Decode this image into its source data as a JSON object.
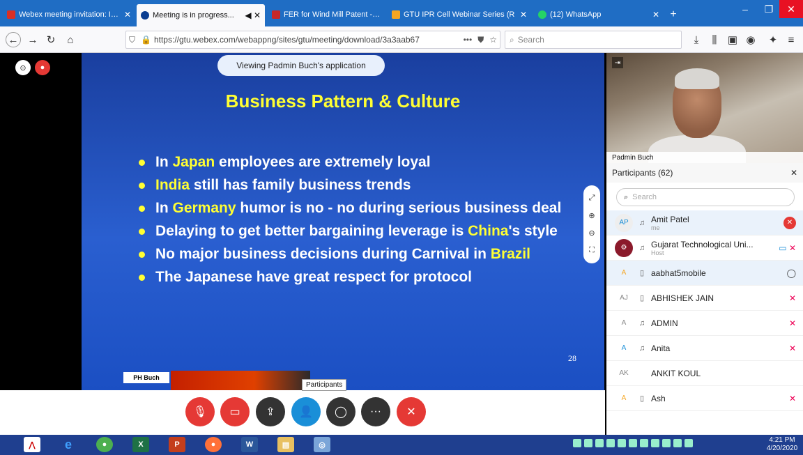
{
  "browser": {
    "tabs": [
      {
        "label": "Webex meeting invitation: Imp",
        "favicon_color": "#d93025",
        "active": false
      },
      {
        "label": "Meeting is in progress...",
        "favicon_color": "#0a3d91",
        "active": true
      },
      {
        "label": "FER for Wind Mill Patent - amit",
        "favicon_color": "#c62828",
        "active": false
      },
      {
        "label": "GTU IPR Cell Webinar Series (R",
        "favicon_color": "#f5a623",
        "active": false
      },
      {
        "label": "(12) WhatsApp",
        "favicon_color": "#25d366",
        "active": false
      }
    ],
    "url": "https://gtu.webex.com/webappng/sites/gtu/meeting/download/3a3aab67",
    "search_placeholder": "Search"
  },
  "meeting": {
    "viewing_banner": "Viewing Padmin Buch's application",
    "slide": {
      "title": "Business Pattern & Culture",
      "bullets": [
        {
          "pre": "In ",
          "hl": "Japan",
          "post": " employees are extremely loyal"
        },
        {
          "pre": "",
          "hl": "India",
          "post": " still has family business trends"
        },
        {
          "pre": "In ",
          "hl": "Germany",
          "post": " humor is no - no during serious business deal"
        },
        {
          "pre": "Delaying to get better bargaining leverage is ",
          "hl": "China",
          "post": "'s style"
        },
        {
          "pre": "No major business decisions during Carnival in ",
          "hl": "Brazil",
          "post": ""
        },
        {
          "pre": "The Japanese have great respect for protocol",
          "hl": "",
          "post": ""
        }
      ],
      "page_number": "28",
      "footer_label": "PH Buch"
    },
    "controls": {
      "mute": "mute",
      "video": "video",
      "share": "share",
      "participants": "participants",
      "chat": "chat",
      "more": "more",
      "leave": "leave"
    },
    "tooltip": "Participants"
  },
  "panel": {
    "camera_name": "Padmin Buch",
    "participants_header": "Participants (62)",
    "search_placeholder": "Search",
    "participants": [
      {
        "initials": "AP",
        "name": "Amit Patel",
        "sub": "me",
        "selected": true
      },
      {
        "initials": "",
        "name": "Gujarat Technological Uni...",
        "sub": "Host",
        "selected": false
      },
      {
        "initials": "A",
        "name": "aabhat5mobile",
        "sub": "",
        "selected": true
      },
      {
        "initials": "AJ",
        "name": "ABHISHEK JAIN",
        "sub": "",
        "selected": false
      },
      {
        "initials": "A",
        "name": "ADMIN",
        "sub": "",
        "selected": false
      },
      {
        "initials": "A",
        "name": "Anita",
        "sub": "",
        "selected": false
      },
      {
        "initials": "AK",
        "name": "ANKIT KOUL",
        "sub": "",
        "selected": false
      },
      {
        "initials": "A",
        "name": "Ash",
        "sub": "",
        "selected": false
      }
    ]
  },
  "taskbar": {
    "time": "4:21 PM",
    "date": "4/20/2020"
  }
}
